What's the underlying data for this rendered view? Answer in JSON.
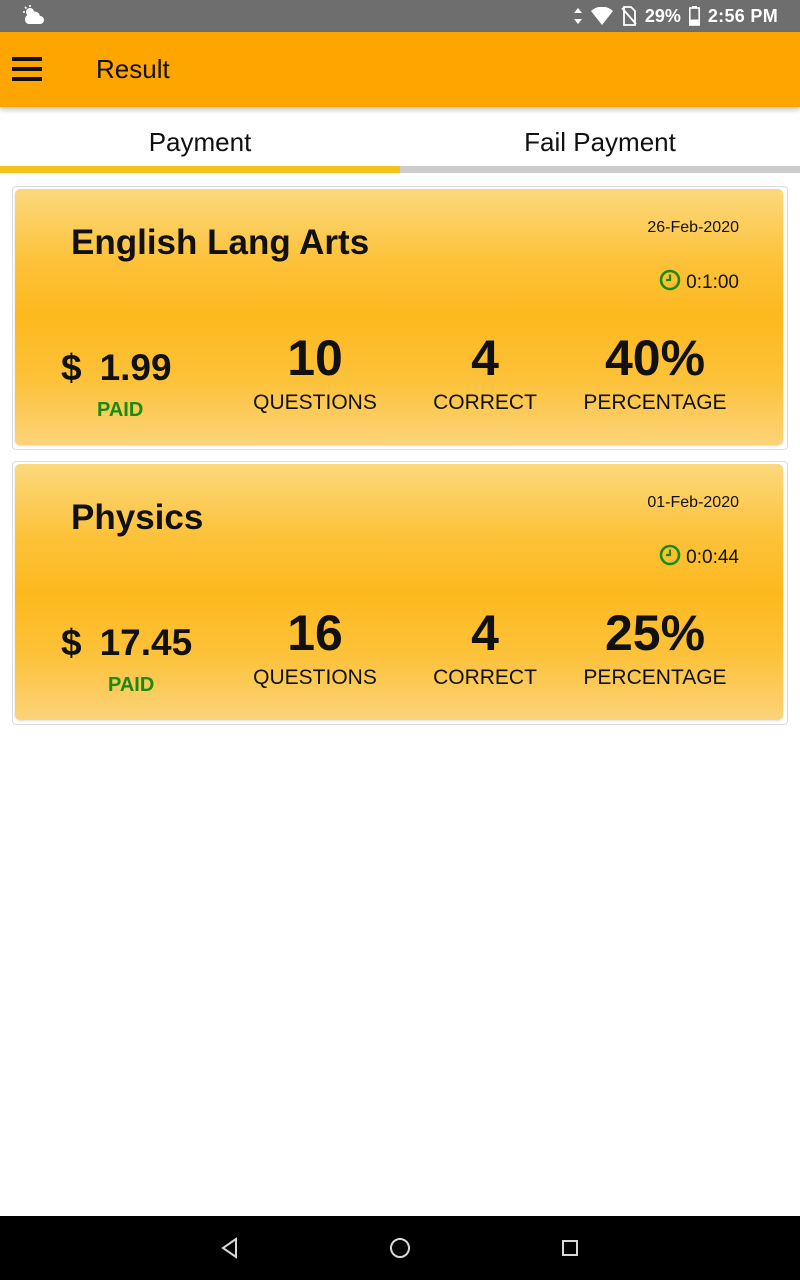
{
  "status_bar": {
    "battery": "29%",
    "time": "2:56 PM",
    "icons": [
      "weather-icon",
      "data-arrows-icon",
      "wifi-icon",
      "no-sim-icon",
      "battery-icon"
    ]
  },
  "app_bar": {
    "title": "Result",
    "menu_icon": "hamburger-menu-icon",
    "background": "#ffa500"
  },
  "tabs": [
    {
      "label": "Payment",
      "selected": true
    },
    {
      "label": "Fail Payment",
      "selected": false
    }
  ],
  "results": [
    {
      "subject": "English Lang Arts",
      "date": "26-Feb-2020",
      "duration": "0:1:00",
      "currency": "$",
      "price": "1.99",
      "payment_status": "PAID",
      "questions": "10",
      "questions_label": "QUESTIONS",
      "correct": "4",
      "correct_label": "CORRECT",
      "percentage": "40%",
      "percentage_label": "PERCENTAGE"
    },
    {
      "subject": "Physics",
      "date": "01-Feb-2020",
      "duration": "0:0:44",
      "currency": "$",
      "price": "17.45",
      "payment_status": "PAID",
      "questions": "16",
      "questions_label": "QUESTIONS",
      "correct": "4",
      "correct_label": "CORRECT",
      "percentage": "25%",
      "percentage_label": "PERCENTAGE"
    }
  ],
  "colors": {
    "accent": "#ffa500",
    "tab_indicator": "#f7c21a",
    "paid_green": "#1a8a10",
    "clock_green": "#1a8a10"
  },
  "nav_bar": {
    "icons": [
      "back-icon",
      "home-icon",
      "recent-apps-icon"
    ]
  }
}
